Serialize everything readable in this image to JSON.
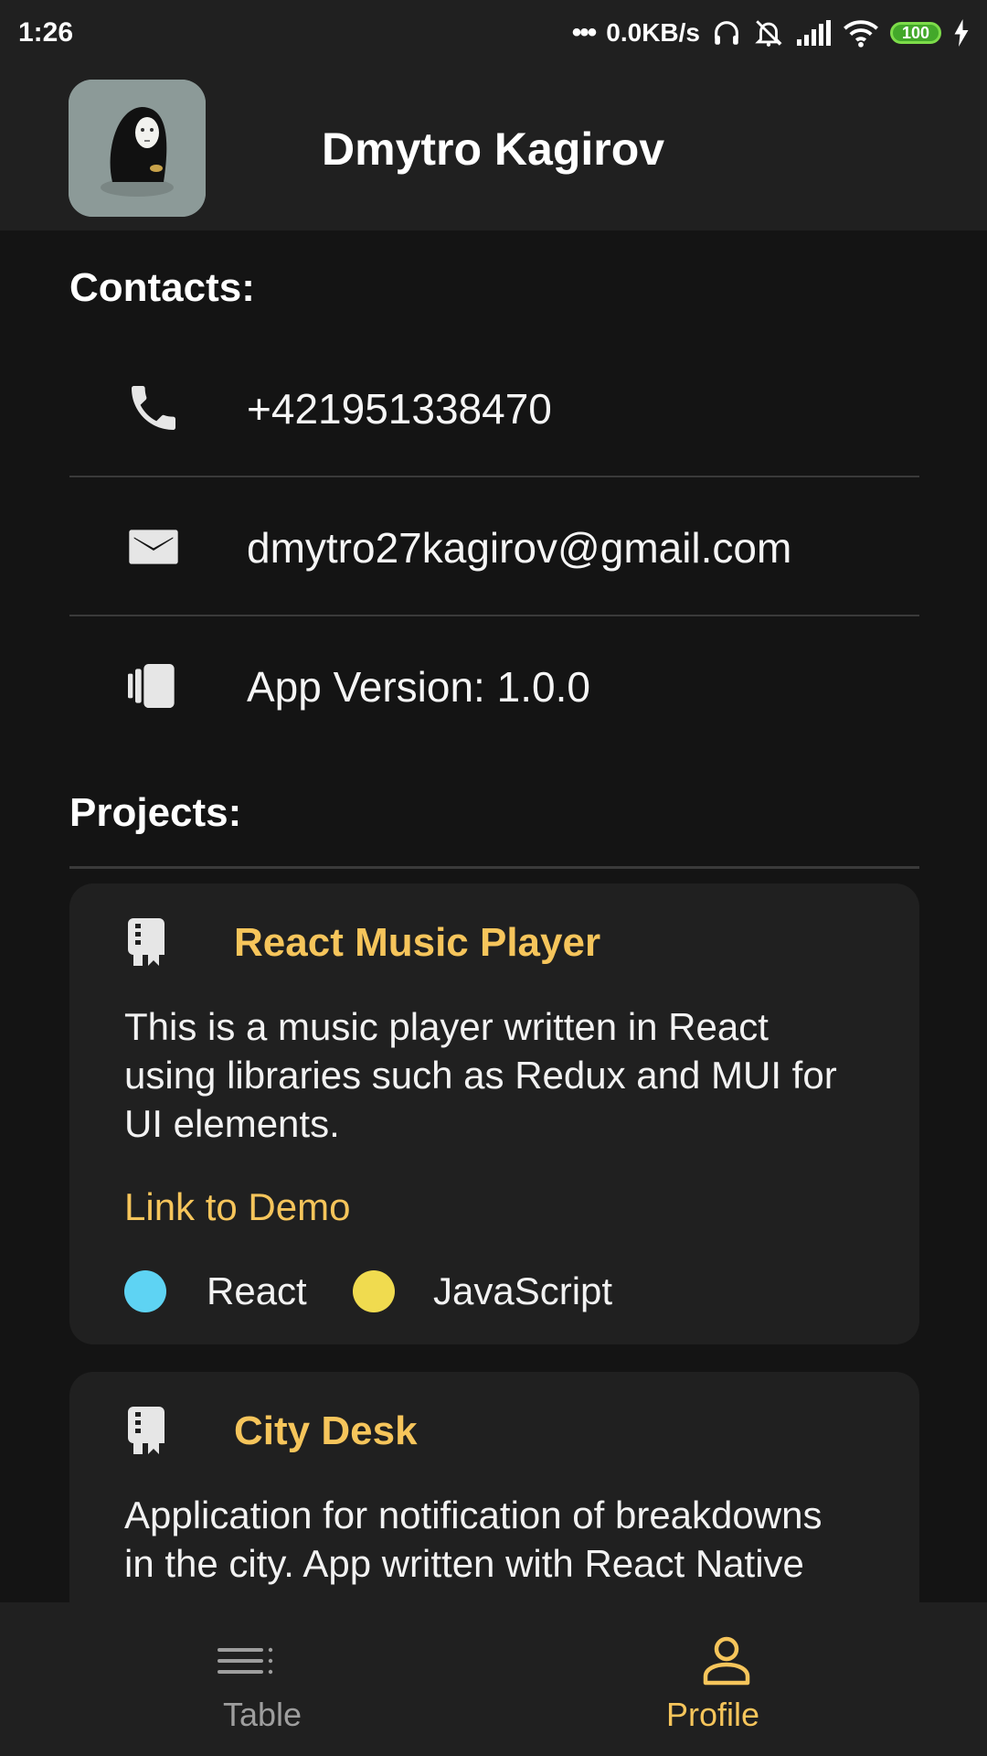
{
  "status_bar": {
    "time": "1:26",
    "network_speed": "0.0KB/s",
    "battery": "100"
  },
  "header": {
    "name": "Dmytro Kagirov"
  },
  "contacts": {
    "heading": "Contacts:",
    "phone": "+421951338470",
    "email": "dmytro27kagirov@gmail.com",
    "version": "App Version: 1.0.0"
  },
  "projects": {
    "heading": "Projects:",
    "items": [
      {
        "title": "React Music Player",
        "description": "This is a music player written in React using libraries such as Redux and MUI for UI elements.",
        "link_label": "Link to Demo",
        "tech": [
          {
            "name": "React",
            "color": "#5ed3f3"
          },
          {
            "name": "JavaScript",
            "color": "#f0db4f"
          }
        ]
      },
      {
        "title": "City Desk",
        "description": "Application for notification of breakdowns in the city. App written with React Native"
      }
    ]
  },
  "bottom_nav": {
    "table_label": "Table",
    "profile_label": "Profile",
    "active": "Profile"
  },
  "colors": {
    "accent": "#f6c55b",
    "background": "#141414",
    "surface": "#202020"
  }
}
